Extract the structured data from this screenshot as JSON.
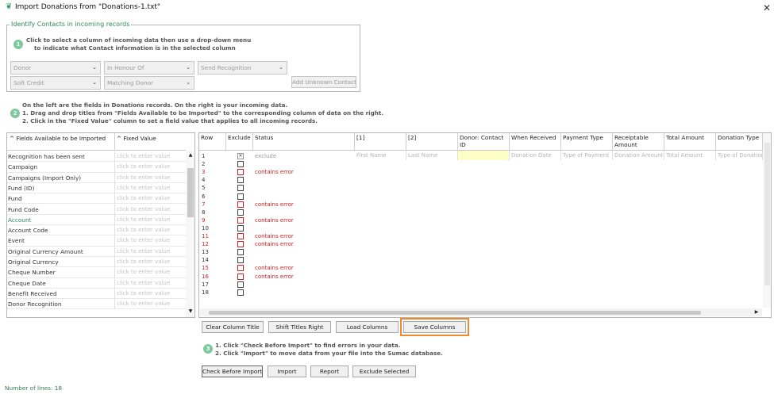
{
  "window": {
    "title": "Import Donations from \"Donations-1.txt\"",
    "icon": "sumac-app-icon",
    "close_glyph": "✕"
  },
  "step1": {
    "legend": "Identify Contacts in incoming records",
    "badge": "1",
    "line1": "Click to select a column of incoming data then use a drop-down menu",
    "line2": "to indicate what Contact information is in the selected column",
    "dropdowns": [
      {
        "value": "Donor"
      },
      {
        "value": "In Honour Of"
      },
      {
        "value": "Send Recognition"
      },
      {
        "value": "Soft Credit"
      },
      {
        "value": "Matching Donor"
      }
    ],
    "add_unknown_label": "Add Unknown Contact"
  },
  "step2": {
    "badge": "2",
    "line1": "On the left are the fields in Donations records.  On the right is your incoming data.",
    "line2": "1. Drag and drop titles from \"Fields Available to be Imported\" to the corresponding column of data on the right.",
    "line3": "2. Click in the \"Fixed Value\" column to set a field value that applies to all incoming records."
  },
  "fields_panel": {
    "col_fields": "Fields Available to be Imported",
    "col_fixed": "Fixed Value",
    "placeholder": "click to enter value",
    "rows": [
      {
        "name": "Recognition has been sent",
        "highlight": false
      },
      {
        "name": "Campaign",
        "highlight": false
      },
      {
        "name": "Campaigns (Import Only)",
        "highlight": false
      },
      {
        "name": "Fund (ID)",
        "highlight": false
      },
      {
        "name": "Fund",
        "highlight": false
      },
      {
        "name": "Fund Code",
        "highlight": false
      },
      {
        "name": "Account",
        "highlight": true
      },
      {
        "name": "Account Code",
        "highlight": false
      },
      {
        "name": "Event",
        "highlight": false
      },
      {
        "name": "Original Currency Amount",
        "highlight": false
      },
      {
        "name": "Original Currency",
        "highlight": false
      },
      {
        "name": "Cheque Number",
        "highlight": false
      },
      {
        "name": "Cheque Date",
        "highlight": false
      },
      {
        "name": "Benefit Received",
        "highlight": false
      },
      {
        "name": "Donor Recognition",
        "highlight": false
      }
    ],
    "highlight_color": "#2e8b57"
  },
  "grid": {
    "headers": [
      "Row",
      "Exclude",
      "Status",
      "[1]",
      "[2]",
      "Donor: Contact ID",
      "When Received",
      "Payment Type",
      "Receiptable Amount",
      "Total Amount",
      "Donation Type"
    ],
    "mapped": [
      "First Name",
      "Last Name",
      "",
      "Donation Date",
      "Type of Payment",
      "Donation Amount",
      "Total Amount",
      "Type of Donation"
    ],
    "rows": [
      {
        "num": "1",
        "status": "exclude",
        "error": false,
        "header_row": true
      },
      {
        "num": "2",
        "status": "",
        "error": false
      },
      {
        "num": "3",
        "status": "contains error",
        "error": true
      },
      {
        "num": "4",
        "status": "",
        "error": false
      },
      {
        "num": "5",
        "status": "",
        "error": false
      },
      {
        "num": "6",
        "status": "",
        "error": false
      },
      {
        "num": "7",
        "status": "contains error",
        "error": true
      },
      {
        "num": "8",
        "status": "",
        "error": false
      },
      {
        "num": "9",
        "status": "contains error",
        "error": true
      },
      {
        "num": "10",
        "status": "",
        "error": false
      },
      {
        "num": "11",
        "status": "contains error",
        "error": true
      },
      {
        "num": "12",
        "status": "contains error",
        "error": true
      },
      {
        "num": "13",
        "status": "",
        "error": false
      },
      {
        "num": "14",
        "status": "",
        "error": false
      },
      {
        "num": "15",
        "status": "contains error",
        "error": true
      },
      {
        "num": "16",
        "status": "contains error",
        "error": true
      },
      {
        "num": "17",
        "status": "",
        "error": false
      },
      {
        "num": "18",
        "status": "",
        "error": false
      }
    ],
    "error_color": "#d02020",
    "contact_id_fill": "#ffffc8"
  },
  "column_buttons": {
    "clear": "Clear Column Title",
    "shift": "Shift Titles Right",
    "load": "Load Columns",
    "save": "Save Columns",
    "save_highlight": "#f08a2c"
  },
  "step3": {
    "badge": "3",
    "line1": "1. Click \"Check Before Import\" to find errors in your data.",
    "line2": "2. Click \"Import\" to move data from your file into the Sumac database."
  },
  "action_buttons": {
    "check": "Check Before Import",
    "import": "Import",
    "report": "Report",
    "exclude": "Exclude Selected"
  },
  "status": {
    "lines": "Number of lines: 18"
  },
  "icons": {
    "scroll_up": "▲",
    "scroll_down": "▼",
    "scroll_right": "▶",
    "sort": "^",
    "dropdown_arrow": "⌄"
  }
}
